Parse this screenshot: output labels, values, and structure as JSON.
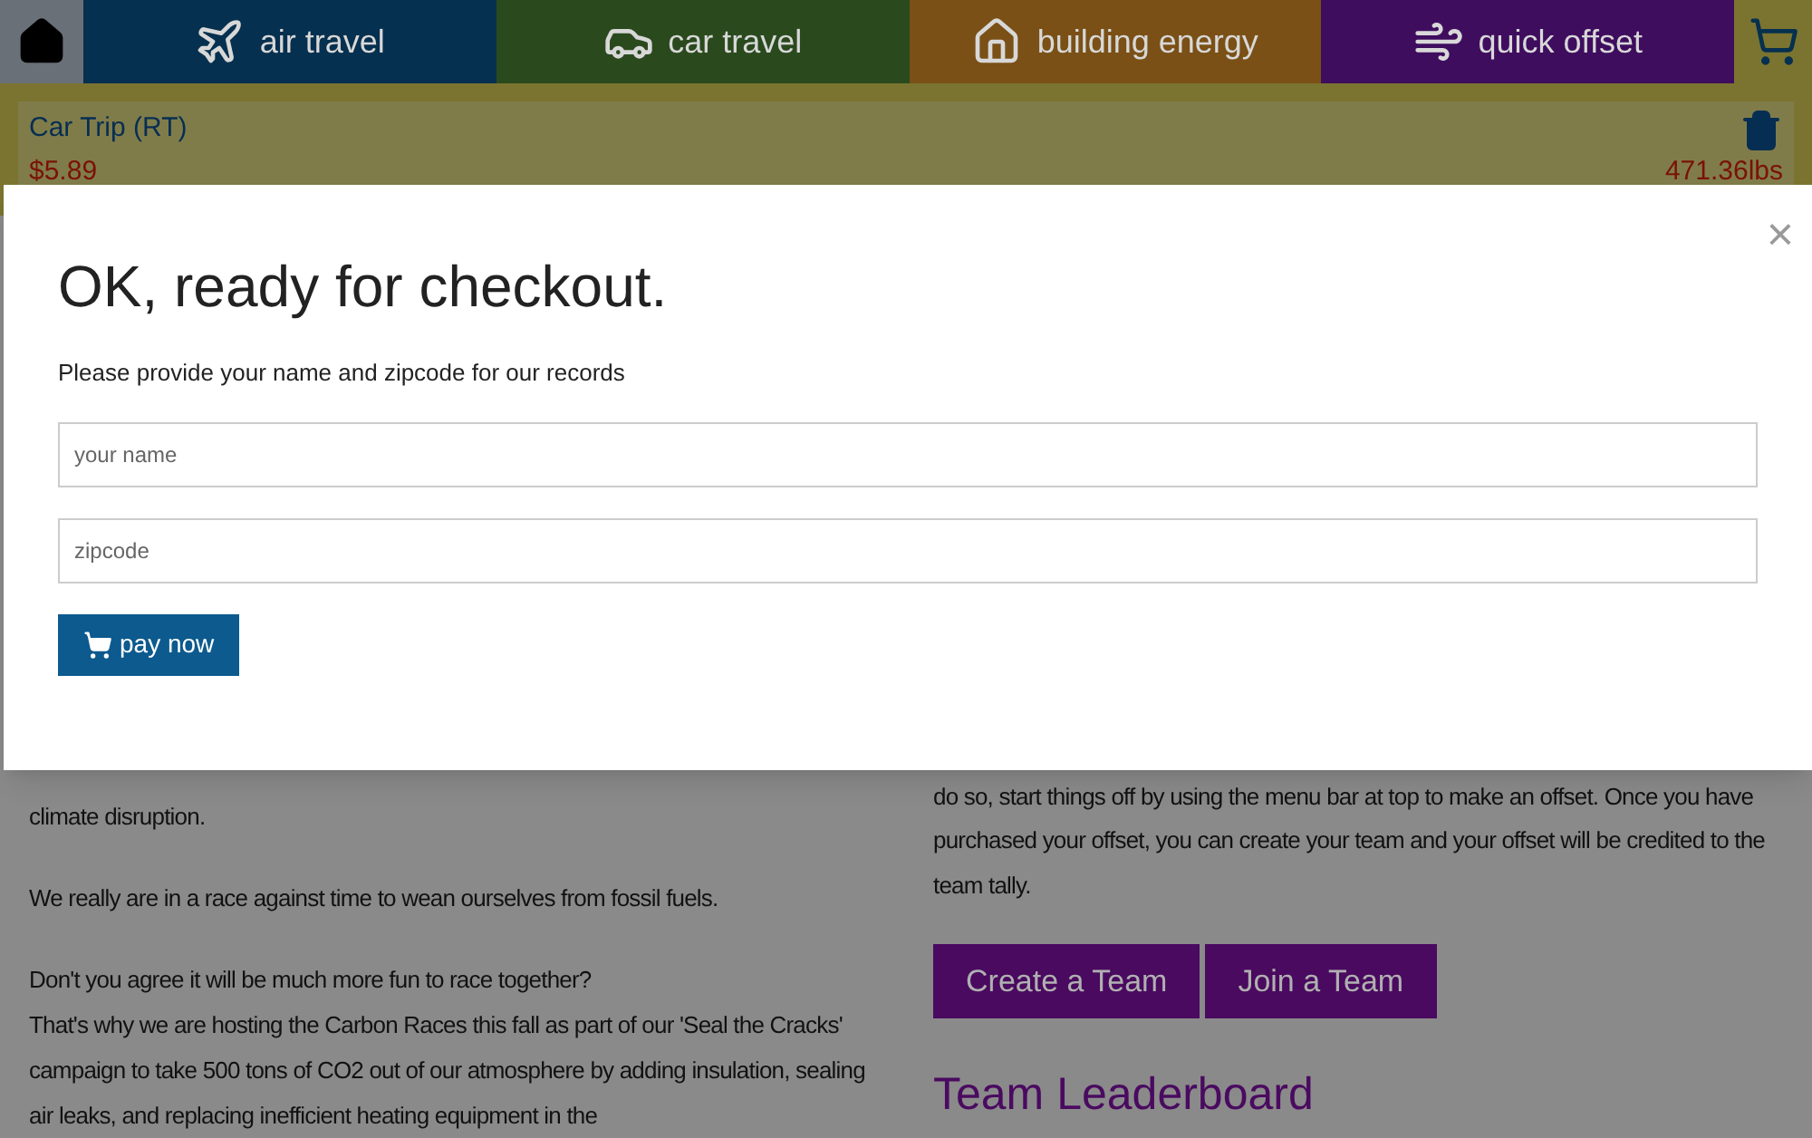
{
  "nav": {
    "tabs": [
      {
        "kind": "air",
        "label": "air travel",
        "color": "#06304f"
      },
      {
        "kind": "car",
        "label": "car travel",
        "color": "#2a4a1e"
      },
      {
        "kind": "building",
        "label": "building energy",
        "color": "#7a5016"
      },
      {
        "kind": "offset",
        "label": "quick offset",
        "color": "#3f0d5e"
      }
    ]
  },
  "cart_item": {
    "title": "Car Trip (RT)",
    "price": "$5.89",
    "weight": "471.36lbs"
  },
  "left_column": {
    "paragraphs": [
      "climate disruption.",
      "We really are in a race against time to wean ourselves from fossil fuels.",
      "Don't you agree it will be much more fun to race together?",
      "That's why we are hosting the Carbon Races this fall as part of our 'Seal the Cracks' campaign to take 500 tons of CO2 out of our atmosphere by adding insulation, sealing air leaks, and replacing inefficient heating equipment in the"
    ]
  },
  "right_column": {
    "paragraph": "do so, start things off by using the menu bar at top to make an offset. Once you have purchased your offset, you can create your team and your offset will be credited to the team tally.",
    "buttons": [
      "Create a Team",
      "Join a Team"
    ],
    "heading": "Team Leaderboard"
  },
  "modal": {
    "close": "×",
    "title": "OK, ready for checkout.",
    "subtitle": "Please provide your name and zipcode for our records",
    "fields": [
      {
        "placeholder": "your name"
      },
      {
        "placeholder": "zipcode"
      }
    ],
    "button": "pay now"
  }
}
